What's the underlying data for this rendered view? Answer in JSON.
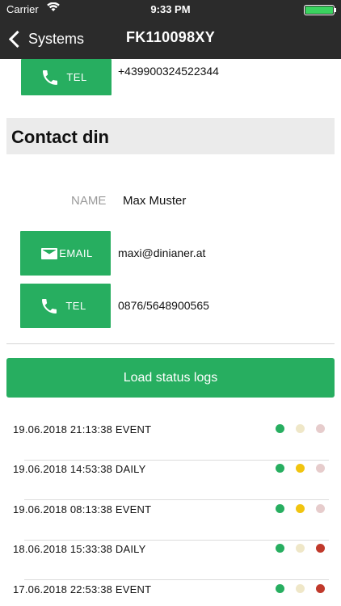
{
  "status_bar": {
    "carrier": "Carrier",
    "time": "9:33 PM"
  },
  "nav": {
    "back_label": "Systems",
    "title": "FK110098XY"
  },
  "top_contact": {
    "tel_label": "TEL",
    "tel_value": "+439900324522344"
  },
  "contact_din": {
    "heading": "Contact din",
    "name_label": "NAME",
    "name_value": "Max Muster",
    "email_label": "EMAIL",
    "email_value": "maxi@dinianer.at",
    "tel_label": "TEL",
    "tel_value": "0876/5648900565"
  },
  "load_button": "Load status logs",
  "colors": {
    "green_button": "#27ae60",
    "dot_green": "#27ae60",
    "dot_yellow": "#f1c40f",
    "dot_red": "#c0392b",
    "dot_faded_yellow": "#efe7c8",
    "dot_faded_red": "#e6cccc"
  },
  "logs": [
    {
      "text": "19.06.2018 21:13:38  EVENT",
      "dots": [
        "green",
        "faded_yellow",
        "faded_red"
      ]
    },
    {
      "text": "19.06.2018 14:53:38  DAILY",
      "dots": [
        "green",
        "yellow",
        "faded_red"
      ]
    },
    {
      "text": "19.06.2018 08:13:38  EVENT",
      "dots": [
        "green",
        "yellow",
        "faded_red"
      ]
    },
    {
      "text": "18.06.2018 15:33:38  DAILY",
      "dots": [
        "green",
        "faded_yellow",
        "red"
      ]
    },
    {
      "text": "17.06.2018 22:53:38  EVENT",
      "dots": [
        "green",
        "faded_yellow",
        "red"
      ]
    }
  ]
}
